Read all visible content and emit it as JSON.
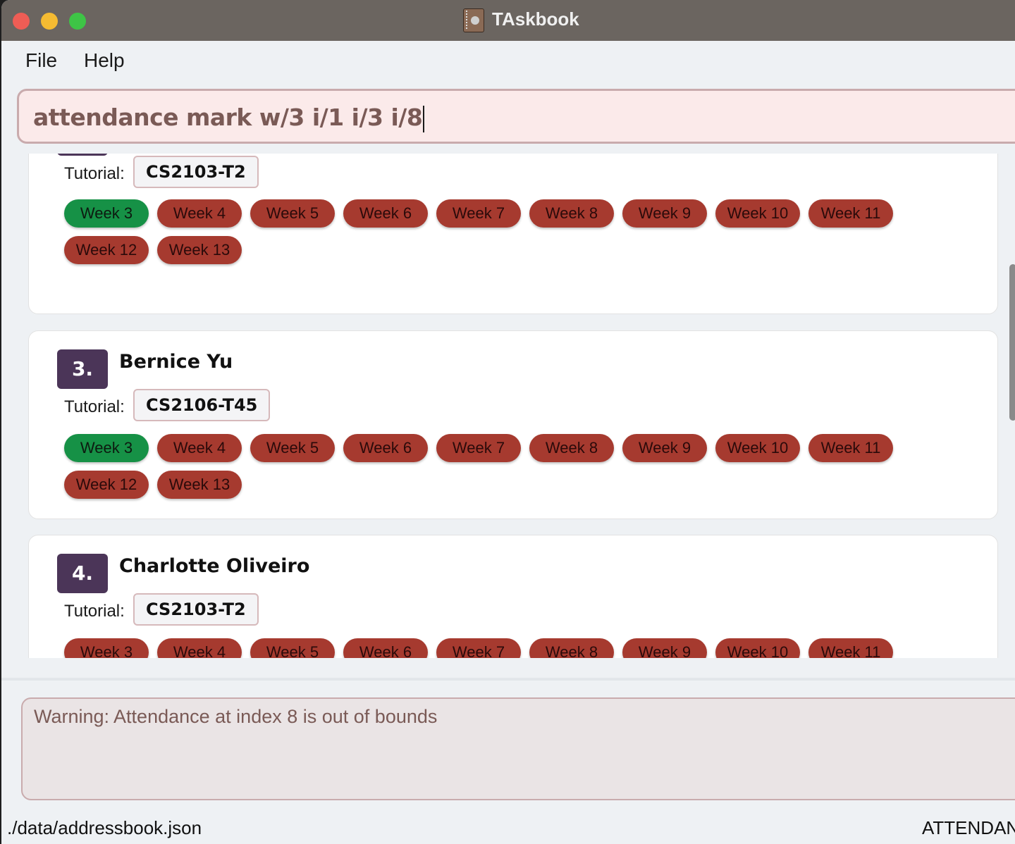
{
  "window": {
    "title": "TAskbook"
  },
  "menu": {
    "file": "File",
    "help": "Help"
  },
  "command": {
    "value": "attendance mark w/3 i/1 i/3 i/8"
  },
  "tutorial_label": "Tutorial:",
  "persons": [
    {
      "tutorial": "CS2103-T2",
      "weeks": [
        {
          "label": "Week 3",
          "present": true
        },
        {
          "label": "Week 4",
          "present": false
        },
        {
          "label": "Week 5",
          "present": false
        },
        {
          "label": "Week 6",
          "present": false
        },
        {
          "label": "Week 7",
          "present": false
        },
        {
          "label": "Week 8",
          "present": false
        },
        {
          "label": "Week 9",
          "present": false
        },
        {
          "label": "Week 10",
          "present": false
        },
        {
          "label": "Week 11",
          "present": false
        },
        {
          "label": "Week 12",
          "present": false
        },
        {
          "label": "Week 13",
          "present": false
        }
      ]
    },
    {
      "index": "3.",
      "name": "Bernice Yu",
      "tutorial": "CS2106-T45",
      "weeks": [
        {
          "label": "Week 3",
          "present": true
        },
        {
          "label": "Week 4",
          "present": false
        },
        {
          "label": "Week 5",
          "present": false
        },
        {
          "label": "Week 6",
          "present": false
        },
        {
          "label": "Week 7",
          "present": false
        },
        {
          "label": "Week 8",
          "present": false
        },
        {
          "label": "Week 9",
          "present": false
        },
        {
          "label": "Week 10",
          "present": false
        },
        {
          "label": "Week 11",
          "present": false
        },
        {
          "label": "Week 12",
          "present": false
        },
        {
          "label": "Week 13",
          "present": false
        }
      ]
    },
    {
      "index": "4.",
      "name": "Charlotte Oliveiro",
      "tutorial": "CS2103-T2",
      "weeks": [
        {
          "label": "Week 3",
          "present": false
        },
        {
          "label": "Week 4",
          "present": false
        },
        {
          "label": "Week 5",
          "present": false
        },
        {
          "label": "Week 6",
          "present": false
        },
        {
          "label": "Week 7",
          "present": false
        },
        {
          "label": "Week 8",
          "present": false
        },
        {
          "label": "Week 9",
          "present": false
        },
        {
          "label": "Week 10",
          "present": false
        },
        {
          "label": "Week 11",
          "present": false
        }
      ]
    }
  ],
  "result": {
    "message": "Warning: Attendance at index 8 is out of bounds"
  },
  "status": {
    "file_path": "./data/addressbook.json",
    "mode": "ATTENDAN"
  },
  "colors": {
    "present": "#169146",
    "absent": "#a63a2f",
    "index_badge": "#4b3558"
  }
}
